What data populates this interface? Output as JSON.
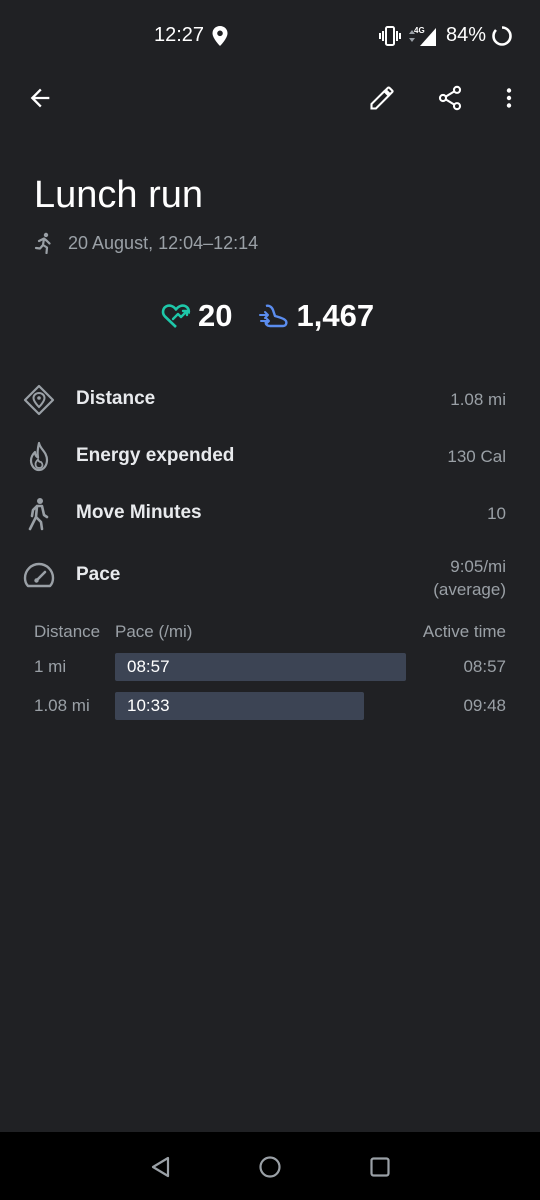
{
  "status_bar": {
    "time": "12:27",
    "battery": "84%",
    "signal_label": "4G"
  },
  "app_bar": {
    "icons": [
      "back-arrow-icon",
      "pencil-icon",
      "share-icon",
      "more-vert-icon"
    ]
  },
  "activity": {
    "title": "Lunch run",
    "date_range": "20 August, 12:04–12:14"
  },
  "goals": {
    "heart_points": "20",
    "steps": "1,467",
    "heart_color": "#1ec7a9",
    "steps_color": "#5b8def"
  },
  "metrics": [
    {
      "label": "Distance",
      "value": "1.08 mi",
      "icon": "distance-icon"
    },
    {
      "label": "Energy expended",
      "value": "130 Cal",
      "icon": "flame-icon"
    },
    {
      "label": "Move Minutes",
      "value": "10",
      "icon": "walking-icon"
    },
    {
      "label": "Pace",
      "value": "9:05/mi",
      "value_note": "(average)",
      "icon": "speedometer-icon"
    }
  ],
  "splits": {
    "headers": {
      "distance": "Distance",
      "pace": "Pace (/mi)",
      "active_time": "Active time"
    },
    "rows": [
      {
        "distance": "1 mi",
        "pace": "08:57",
        "active_time": "08:57",
        "bar_fraction": 0.97
      },
      {
        "distance": "1.08 mi",
        "pace": "10:33",
        "active_time": "09:48",
        "bar_fraction": 0.83
      }
    ]
  },
  "colors": {
    "background": "#202124",
    "bar": "#3c4454",
    "nav_bar": "#000000"
  }
}
